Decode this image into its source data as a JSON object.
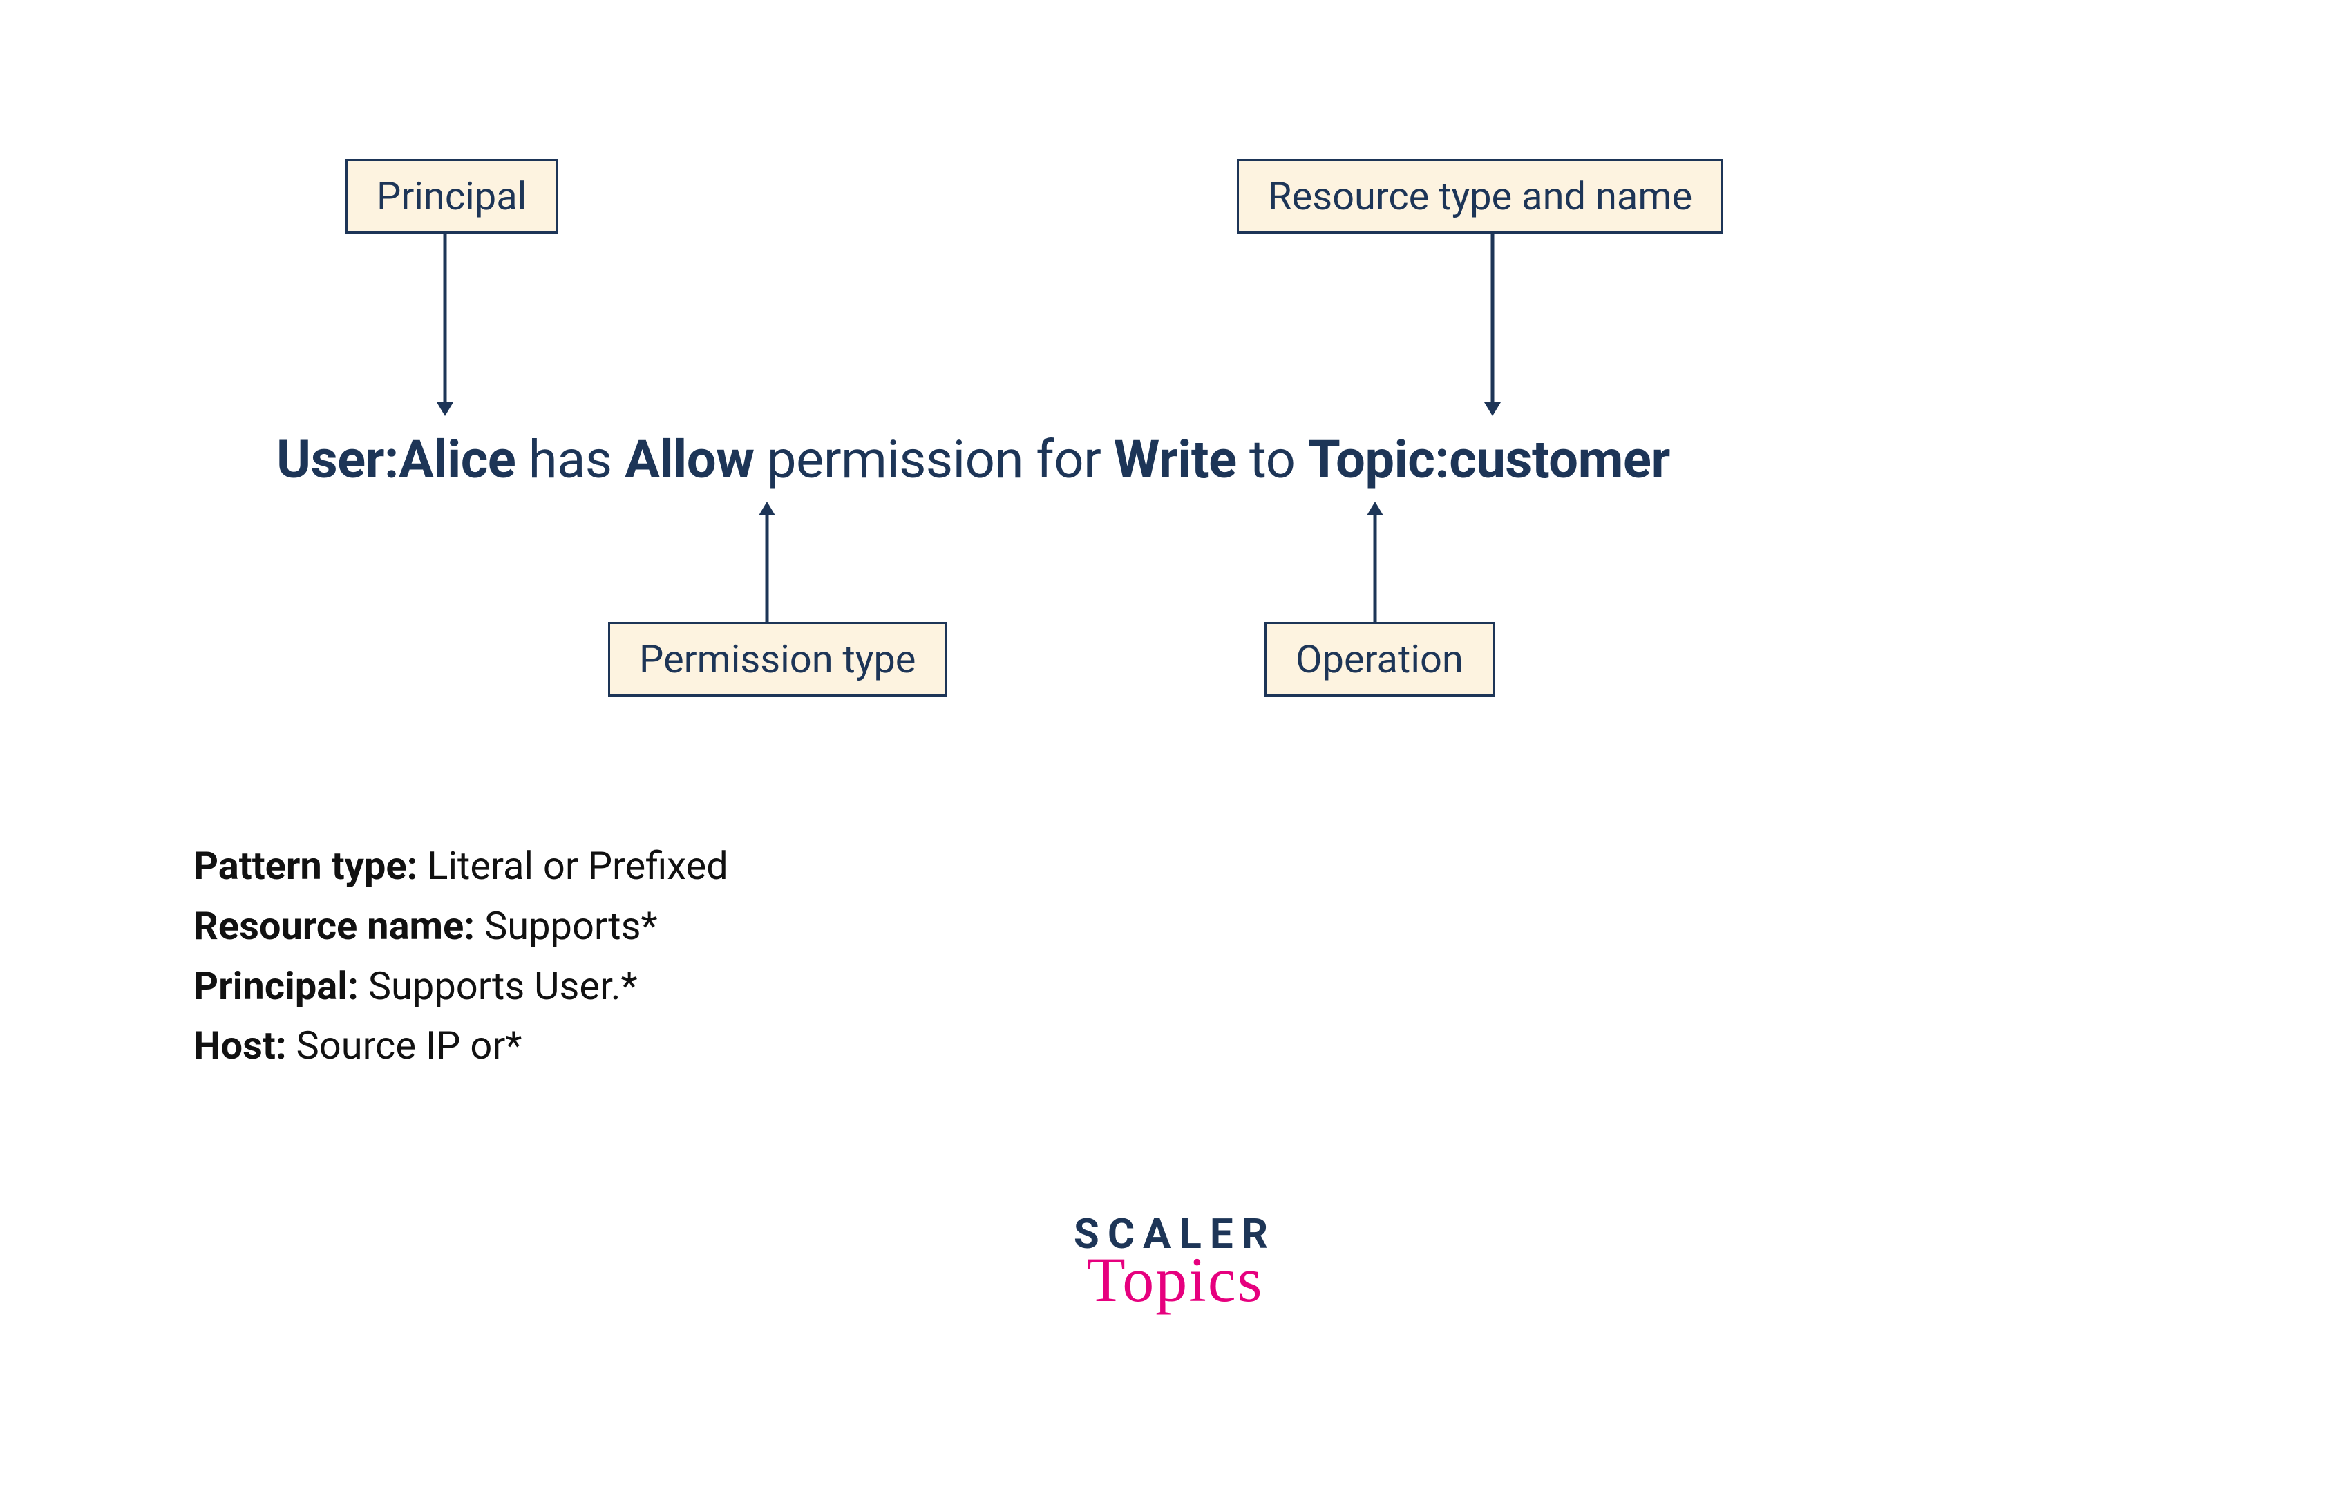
{
  "labels": {
    "principal": "Principal",
    "resource": "Resource type and name",
    "permission": "Permission type",
    "operation": "Operation"
  },
  "sentence": {
    "p1_bold": "User:Alice",
    "p2": " has ",
    "p3_bold": "Allow",
    "p4": " permission for ",
    "p5_bold": "Write",
    "p6": " to ",
    "p7_bold": "Topic:customer"
  },
  "notes": {
    "pattern_type": {
      "label": "Pattern type:",
      "value": " Literal or Prefixed"
    },
    "resource_name": {
      "label": "Resource name:",
      "value": " Supports*"
    },
    "principal": {
      "label": "Principal:",
      "value": " Supports User.*"
    },
    "host": {
      "label": "Host:",
      "value": " Source IP or*"
    }
  },
  "logo": {
    "line1": "SCALER",
    "line2": "Topics"
  },
  "colors": {
    "box_bg": "#fdf3e0",
    "box_border": "#1d3557",
    "arrow": "#1d3557",
    "text_dark": "#1d3557",
    "accent_pink": "#e6007e"
  }
}
